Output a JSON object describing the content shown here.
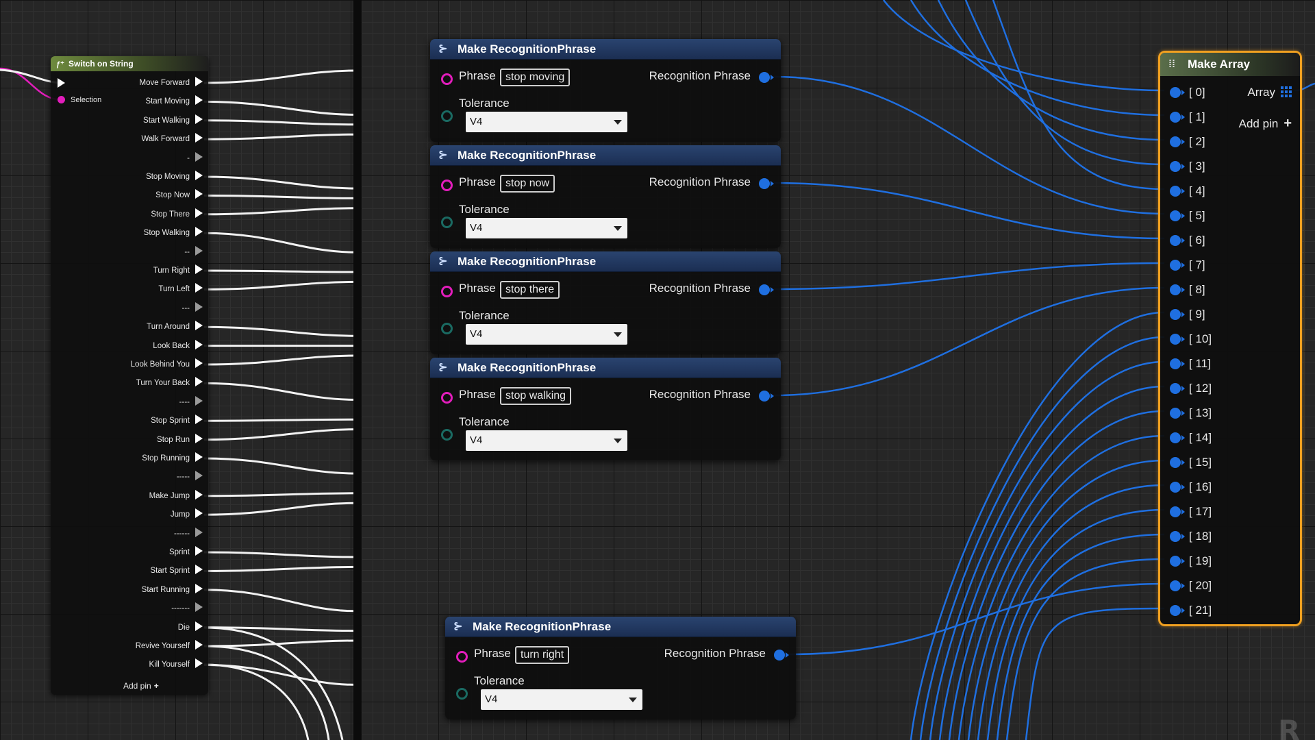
{
  "switch_node": {
    "title": "Switch on String",
    "icon": "function-icon",
    "selection_label": "Selection",
    "outputs": [
      "Move Forward",
      "Start Moving",
      "Start Walking",
      "Walk Forward",
      "-",
      "Stop Moving",
      "Stop Now",
      "Stop There",
      "Stop Walking",
      "--",
      "Turn Right",
      "Turn Left",
      "---",
      "Turn Around",
      "Look Back",
      "Look Behind You",
      "Turn Your Back",
      "----",
      "Stop Sprint",
      "Stop Run",
      "Stop Running",
      "-----",
      "Make Jump",
      "Jump",
      "------",
      "Sprint",
      "Start Sprint",
      "Start Running",
      "-------",
      "Die",
      "Revive Yourself",
      "Kill Yourself"
    ],
    "add_pin_label": "Add pin"
  },
  "phrase_nodes": [
    {
      "title": "Make RecognitionPhrase",
      "phrase_label": "Phrase",
      "phrase_value": "stop moving",
      "output_label": "Recognition Phrase",
      "tolerance_label": "Tolerance",
      "tolerance_value": "V4"
    },
    {
      "title": "Make RecognitionPhrase",
      "phrase_label": "Phrase",
      "phrase_value": "stop now",
      "output_label": "Recognition Phrase",
      "tolerance_label": "Tolerance",
      "tolerance_value": "V4"
    },
    {
      "title": "Make RecognitionPhrase",
      "phrase_label": "Phrase",
      "phrase_value": "stop there",
      "output_label": "Recognition Phrase",
      "tolerance_label": "Tolerance",
      "tolerance_value": "V4"
    },
    {
      "title": "Make RecognitionPhrase",
      "phrase_label": "Phrase",
      "phrase_value": "stop walking",
      "output_label": "Recognition Phrase",
      "tolerance_label": "Tolerance",
      "tolerance_value": "V4"
    },
    {
      "title": "Make RecognitionPhrase",
      "phrase_label": "Phrase",
      "phrase_value": "turn right",
      "output_label": "Recognition Phrase",
      "tolerance_label": "Tolerance",
      "tolerance_value": "V4"
    }
  ],
  "array_node": {
    "title": "Make Array",
    "output_label": "Array",
    "add_pin_label": "Add pin",
    "inputs": [
      "[ 0]",
      "[ 1]",
      "[ 2]",
      "[ 3]",
      "[ 4]",
      "[ 5]",
      "[ 6]",
      "[ 7]",
      "[ 8]",
      "[ 9]",
      "[ 10]",
      "[ 11]",
      "[ 12]",
      "[ 13]",
      "[ 14]",
      "[ 15]",
      "[ 16]",
      "[ 17]",
      "[ 18]",
      "[ 19]",
      "[ 20]",
      "[ 21]"
    ]
  },
  "colors": {
    "exec_wire": "#ffffff",
    "string_pin": "#e21dbb",
    "struct_wire": "#1f6fe0",
    "selected_outline": "#f0a020",
    "enum_pin": "#1a6a62"
  }
}
